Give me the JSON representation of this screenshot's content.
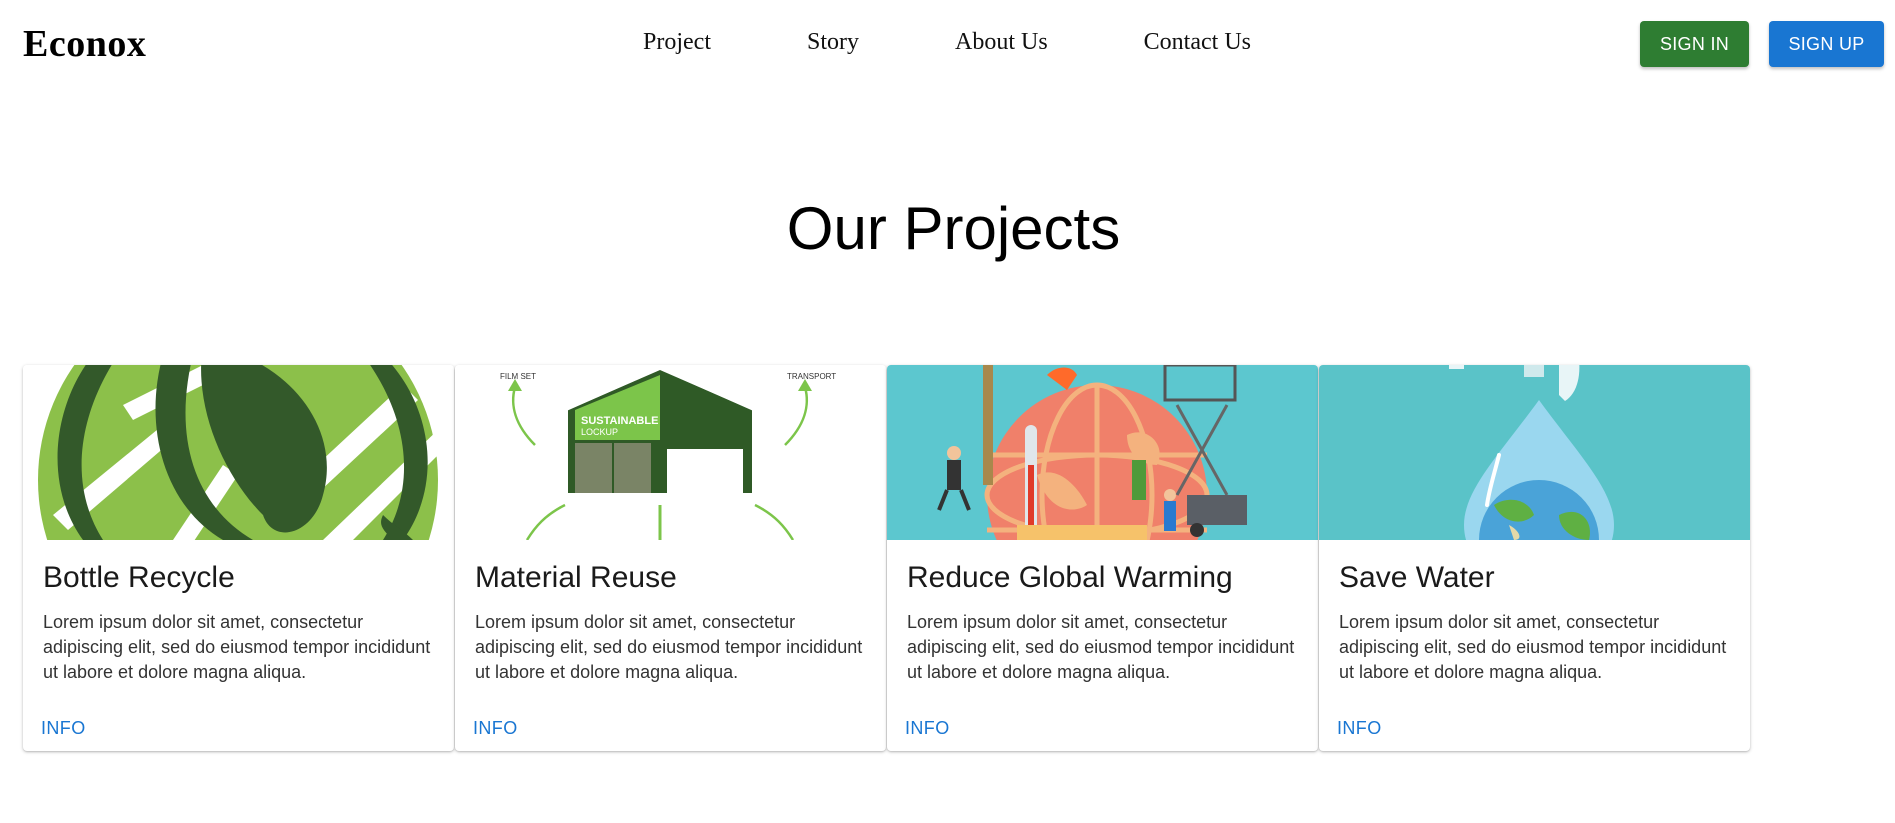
{
  "header": {
    "logo": "Econox",
    "nav": [
      "Project",
      "Story",
      "About Us",
      "Contact Us"
    ],
    "sign_in": "SIGN IN",
    "sign_up": "SIGN UP"
  },
  "main": {
    "title": "Our Projects",
    "cards": [
      {
        "title": "Bottle Recycle",
        "text": "Lorem ipsum dolor sit amet, consectetur adipiscing elit, sed do eiusmod tempor incididunt ut labore et dolore magna aliqua.",
        "action": "INFO",
        "image": "recycle-leaf-illustration"
      },
      {
        "title": "Material Reuse",
        "text": "Lorem ipsum dolor sit amet, consectetur adipiscing elit, sed do eiusmod tempor incididunt ut labore et dolore magna aliqua.",
        "action": "INFO",
        "image": "sustainable-lockup-illustration",
        "image_labels": [
          "SUSTAINABLE",
          "LOCKUP",
          "FILM SET",
          "TRANSPORT"
        ]
      },
      {
        "title": "Reduce Global Warming",
        "text": "Lorem ipsum dolor sit amet, consectetur adipiscing elit, sed do eiusmod tempor incididunt ut labore et dolore magna aliqua.",
        "action": "INFO",
        "image": "globe-thermometer-illustration"
      },
      {
        "title": "Save Water",
        "text": "Lorem ipsum dolor sit amet, consectetur adipiscing elit, sed do eiusmod tempor incididunt ut labore et dolore magna aliqua.",
        "action": "INFO",
        "image": "water-drop-earth-illustration"
      }
    ]
  },
  "colors": {
    "sign_in_bg": "#2e7d32",
    "sign_up_bg": "#1976d2",
    "link": "#1976d2",
    "leaf_light": "#8cc04a",
    "leaf_dark": "#33592a",
    "sky_teal": "#5cc7cf"
  }
}
